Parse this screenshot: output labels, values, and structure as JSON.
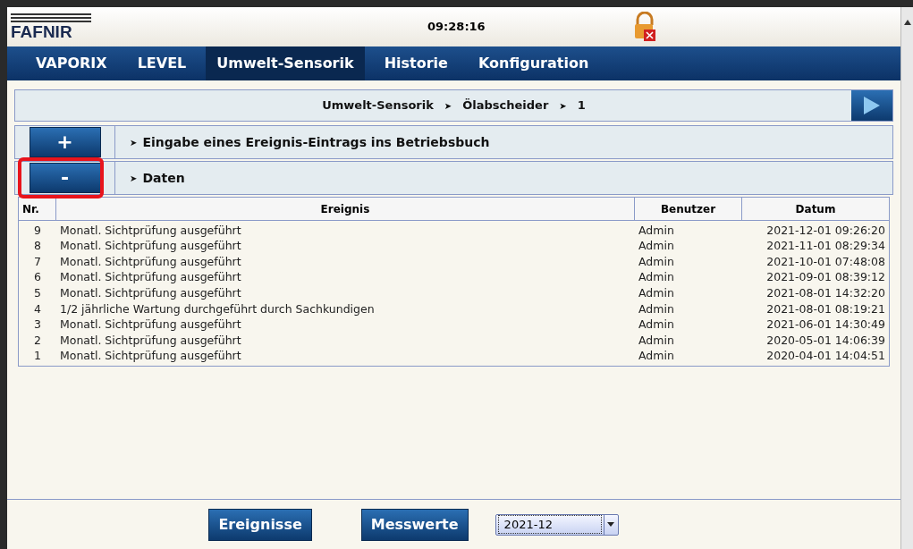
{
  "header": {
    "logo": "FAFNIR",
    "clock": "09:28:16",
    "locked": true
  },
  "tabs": [
    {
      "label": "VAPORIX",
      "selected": false
    },
    {
      "label": "LEVEL",
      "selected": false
    },
    {
      "label": "Umwelt-Sensorik",
      "selected": true
    },
    {
      "label": "Historie",
      "selected": false
    },
    {
      "label": "Konfiguration",
      "selected": false
    }
  ],
  "breadcrumb": [
    {
      "label": "Umwelt-Sensorik"
    },
    {
      "label": "Ölabscheider"
    },
    {
      "label": "1"
    }
  ],
  "breadcrumb_separator": "➤",
  "sections": [
    {
      "button": "+",
      "marker": "➤",
      "title": "Eingabe eines Ereignis-Eintrags ins Betriebsbuch",
      "highlighted": false
    },
    {
      "button": "-",
      "marker": "➤",
      "title": "Daten",
      "highlighted": true
    }
  ],
  "table": {
    "columns": [
      "Nr.",
      "Ereignis",
      "Benutzer",
      "Datum"
    ],
    "rows": [
      [
        "9",
        "Monatl. Sichtprüfung ausgeführt",
        "Admin",
        "2021-12-01 09:26:20"
      ],
      [
        "8",
        "Monatl. Sichtprüfung ausgeführt",
        "Admin",
        "2021-11-01 08:29:34"
      ],
      [
        "7",
        "Monatl. Sichtprüfung ausgeführt",
        "Admin",
        "2021-10-01 07:48:08"
      ],
      [
        "6",
        "Monatl. Sichtprüfung ausgeführt",
        "Admin",
        "2021-09-01 08:39:12"
      ],
      [
        "5",
        "Monatl. Sichtprüfung ausgeführt",
        "Admin",
        "2021-08-01 14:32:20"
      ],
      [
        "4",
        "1/2 jährliche Wartung durchgeführt durch Sachkundigen",
        "Admin",
        "2021-08-01 08:19:21"
      ],
      [
        "3",
        "Monatl. Sichtprüfung ausgeführt",
        "Admin",
        "2021-06-01 14:30:49"
      ],
      [
        "2",
        "Monatl. Sichtprüfung ausgeführt",
        "Admin",
        "2020-05-01 14:06:39"
      ],
      [
        "1",
        "Monatl. Sichtprüfung ausgeführt",
        "Admin",
        "2020-04-01 14:04:51"
      ]
    ]
  },
  "footer": {
    "buttons": [
      "Ereignisse",
      "Messwerte"
    ],
    "month_select": {
      "value": "2021-12"
    }
  }
}
